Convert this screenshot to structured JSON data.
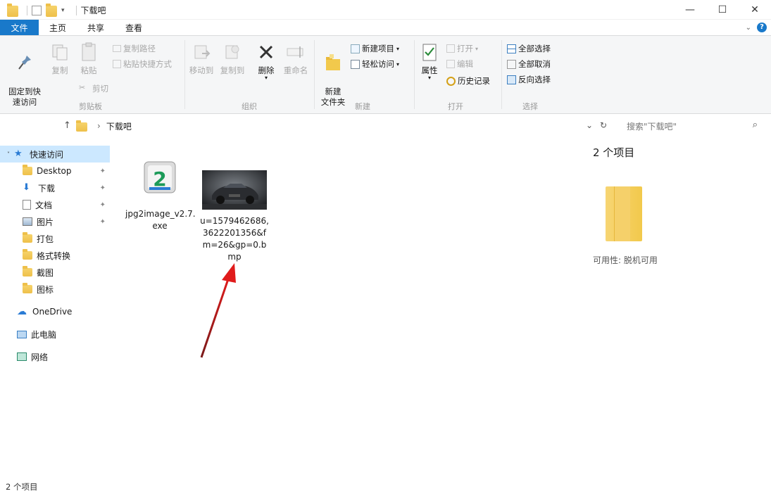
{
  "window": {
    "title": "下载吧",
    "controls": [
      "—",
      "☐",
      "✕"
    ]
  },
  "ribbon": {
    "tabs": [
      "文件",
      "主页",
      "共享",
      "查看"
    ],
    "clipboard": {
      "label": "剪贴板",
      "pin": "固定到快\n速访问",
      "copy": "复制",
      "paste": "粘贴",
      "copy_path": "复制路径",
      "paste_shortcut": "粘贴快捷方式",
      "cut": "剪切"
    },
    "organize": {
      "label": "组织",
      "move_to": "移动到",
      "copy_to": "复制到",
      "delete": "删除",
      "rename": "重命名"
    },
    "new": {
      "label": "新建",
      "new_folder": "新建\n文件夹",
      "new_item": "新建项目",
      "easy_access": "轻松访问"
    },
    "open": {
      "label": "打开",
      "properties": "属性",
      "open": "打开",
      "edit": "编辑",
      "history": "历史记录"
    },
    "select": {
      "label": "选择",
      "select_all": "全部选择",
      "select_none": "全部取消",
      "invert": "反向选择"
    }
  },
  "address": {
    "path": [
      "下载吧"
    ],
    "search_placeholder": "搜索\"下载吧\""
  },
  "nav_pane": {
    "items": [
      {
        "label": "快速访问",
        "selected": true
      },
      {
        "label": "Desktop"
      },
      {
        "label": "下载"
      },
      {
        "label": "文档"
      },
      {
        "label": "图片"
      },
      {
        "label": "打包"
      },
      {
        "label": "格式转换"
      },
      {
        "label": "截图"
      },
      {
        "label": "图标"
      },
      {
        "label": "OneDrive"
      },
      {
        "label": "此电脑"
      },
      {
        "label": "网络"
      }
    ]
  },
  "files": [
    {
      "name": "jpg2image_v2.7.\nexe",
      "icon": "jpg2image-app-icon"
    },
    {
      "name": "u=1579462686,\n3622201356&f\nm=26&gp=0.b\nmp",
      "icon": "car-thumbnail"
    }
  ],
  "preview": {
    "count": "2 个项目",
    "availability": "可用性:  脱机可用"
  },
  "status": {
    "count": "2 个项目"
  }
}
